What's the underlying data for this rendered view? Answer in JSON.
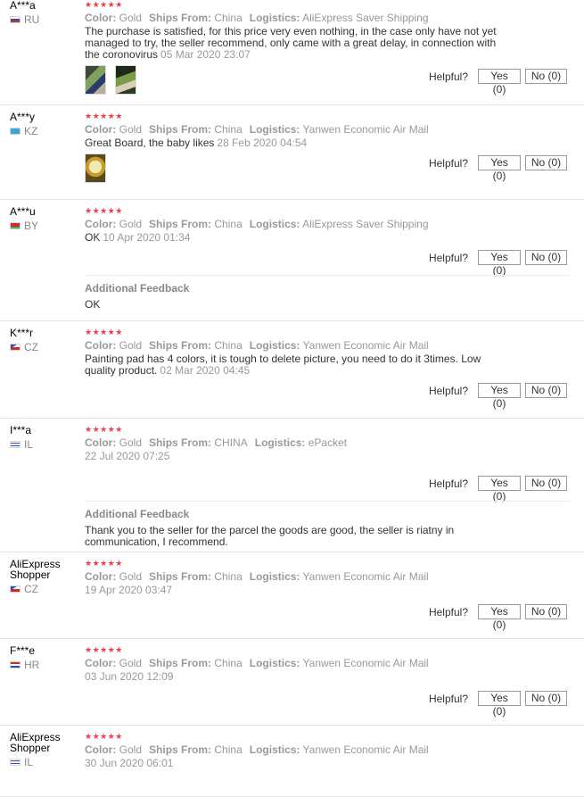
{
  "labels": {
    "color": "Color:",
    "ships_from": "Ships From:",
    "logistics": "Logistics:",
    "helpful": "Helpful?",
    "additional_feedback": "Additional Feedback",
    "star_glyphs": "★★★★★"
  },
  "colors": {
    "star_filled": "#f0404c",
    "star_empty": "#cccccc",
    "text": "#333333",
    "muted": "#999999"
  },
  "reviews": [
    {
      "user": "A***a",
      "country": "RU",
      "rating": 5,
      "color": "Gold",
      "ships_from": "China",
      "logistics": "AliExpress Saver Shipping",
      "text": "The purchase is satisfied, for this price very even nothing, in the case only have not yet managed to try, the seller recommend, only came with a great delay, in connection with the coronovirus",
      "date": "05 Mar 2020 23:07",
      "images": [
        "photo-1",
        "photo-2"
      ],
      "yes": "Yes (0)",
      "no": "No (0)"
    },
    {
      "user": "A***y",
      "country": "KZ",
      "rating": 5,
      "color": "Gold",
      "ships_from": "China",
      "logistics": "Yanwen Economic Air Mail",
      "text": "Great Board, the baby likes",
      "date": "28 Feb 2020 04:54",
      "images": [
        "photo-1"
      ],
      "yes": "Yes (0)",
      "no": "No (0)"
    },
    {
      "user": "A***u",
      "country": "BY",
      "rating": 5,
      "color": "Gold",
      "ships_from": "China",
      "logistics": "AliExpress Saver Shipping",
      "text": "OK",
      "date": "10 Apr 2020 01:34",
      "yes": "Yes (0)",
      "no": "No (0)",
      "additional": "OK"
    },
    {
      "user": "K***r",
      "country": "CZ",
      "rating": 4,
      "color": "Gold",
      "ships_from": "China",
      "logistics": "Yanwen Economic Air Mail",
      "text": "Painting pad has 4 colors, it is tough to delete picture, you need to do it 3times. Low quality product.",
      "date": "02 Mar 2020 04:45",
      "yes": "Yes (0)",
      "no": "No (0)"
    },
    {
      "user": "I***a",
      "country": "IL",
      "rating": 5,
      "color": "Gold",
      "ships_from": "CHINA",
      "logistics": "ePacket",
      "text": "",
      "date": "22 Jul 2020 07:25",
      "yes": "Yes (0)",
      "no": "No (0)",
      "additional": "Thank you to the seller for the parcel the goods are good, the seller is riatny in communication, I recommend."
    },
    {
      "user": "AliExpress Shopper",
      "country": "CZ",
      "rating": 5,
      "color": "Gold",
      "ships_from": "China",
      "logistics": "Yanwen Economic Air Mail",
      "text": "",
      "date": "19 Apr 2020 03:47",
      "yes": "Yes (0)",
      "no": "No (0)"
    },
    {
      "user": "F***e",
      "country": "HR",
      "rating": 5,
      "color": "Gold",
      "ships_from": "China",
      "logistics": "Yanwen Economic Air Mail",
      "text": "",
      "date": "03 Jun 2020 12:09",
      "yes": "Yes (0)",
      "no": "No (0)"
    },
    {
      "user": "AliExpress Shopper",
      "country": "IL",
      "rating": 5,
      "color": "Gold",
      "ships_from": "China",
      "logistics": "Yanwen Economic Air Mail",
      "text": "",
      "date": "30 Jun 2020 06:01"
    }
  ]
}
